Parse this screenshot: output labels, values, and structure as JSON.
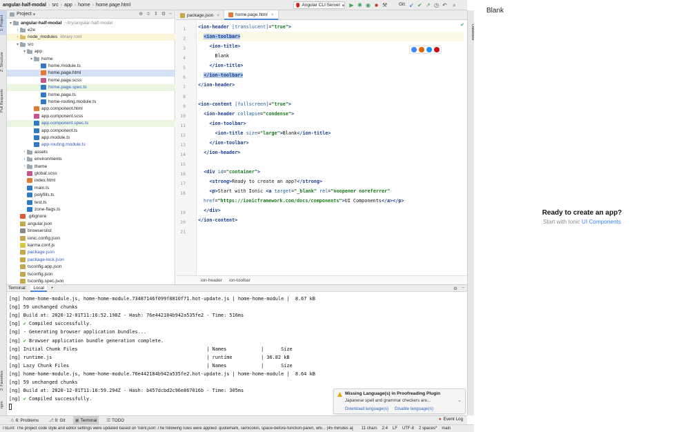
{
  "breadcrumb": [
    "angular-half-modal",
    "src",
    "app",
    "home",
    "home.page.html"
  ],
  "run_config": "Angular CLI Server",
  "git_label": "Git:",
  "left_tool_tabs": [
    "1: Project",
    "Z: Structure",
    "Pull Requests",
    "2: Favorites",
    "npm"
  ],
  "right_tool_tabs": [
    "Database"
  ],
  "project_panel": {
    "title": "Project",
    "tree": [
      {
        "label": "angular-half-modal",
        "hint": "~/try/angular-half-modal",
        "icon": "folder",
        "depth": 0,
        "open": true,
        "bold": true
      },
      {
        "label": "e2e",
        "icon": "folder",
        "depth": 1,
        "open": false
      },
      {
        "label": "node_modules",
        "hint": "library root",
        "icon": "fmod",
        "depth": 1,
        "open": false,
        "style": "hl"
      },
      {
        "label": "src",
        "icon": "folder",
        "depth": 1,
        "open": true
      },
      {
        "label": "app",
        "icon": "folder",
        "depth": 2,
        "open": true
      },
      {
        "label": "home",
        "icon": "folder",
        "depth": 3,
        "open": true
      },
      {
        "label": "home.module.ts",
        "icon": "ts",
        "depth": 4
      },
      {
        "label": "home.page.html",
        "icon": "html",
        "depth": 4,
        "style": "sel"
      },
      {
        "label": "home.page.scss",
        "icon": "scss",
        "depth": 4
      },
      {
        "label": "home.page.spec.ts",
        "icon": "ts",
        "depth": 4,
        "style": "gn",
        "color": "blue"
      },
      {
        "label": "home.page.ts",
        "icon": "ts",
        "depth": 4
      },
      {
        "label": "home-routing.module.ts",
        "icon": "ts",
        "depth": 4
      },
      {
        "label": "app.component.html",
        "icon": "html",
        "depth": 3
      },
      {
        "label": "app.component.scss",
        "icon": "scss",
        "depth": 3
      },
      {
        "label": "app.component.spec.ts",
        "icon": "ts",
        "depth": 3,
        "style": "gn",
        "color": "blue"
      },
      {
        "label": "app.component.ts",
        "icon": "ts",
        "depth": 3
      },
      {
        "label": "app.module.ts",
        "icon": "ts",
        "depth": 3
      },
      {
        "label": "app-routing.module.ts",
        "icon": "ts",
        "depth": 3,
        "color": "blue"
      },
      {
        "label": "assets",
        "icon": "folder",
        "depth": 2,
        "open": false
      },
      {
        "label": "environments",
        "icon": "folder",
        "depth": 2,
        "open": false
      },
      {
        "label": "theme",
        "icon": "folder",
        "depth": 2,
        "open": false
      },
      {
        "label": "global.scss",
        "icon": "scss",
        "depth": 2
      },
      {
        "label": "index.html",
        "icon": "html",
        "depth": 2
      },
      {
        "label": "main.ts",
        "icon": "ts",
        "depth": 2
      },
      {
        "label": "polyfills.ts",
        "icon": "ts",
        "depth": 2
      },
      {
        "label": "test.ts",
        "icon": "ts",
        "depth": 2
      },
      {
        "label": "zone-flags.ts",
        "icon": "ts",
        "depth": 2
      },
      {
        "label": ".gitignore",
        "icon": "git",
        "depth": 1
      },
      {
        "label": "angular.json",
        "icon": "json",
        "depth": 1
      },
      {
        "label": "browserslist",
        "icon": "cfg",
        "depth": 1
      },
      {
        "label": "ionic.config.json",
        "icon": "json",
        "depth": 1
      },
      {
        "label": "karma.conf.js",
        "icon": "js",
        "depth": 1
      },
      {
        "label": "package.json",
        "icon": "json",
        "depth": 1,
        "color": "blue"
      },
      {
        "label": "package-lock.json",
        "icon": "json",
        "depth": 1,
        "color": "blue"
      },
      {
        "label": "tsconfig.app.json",
        "icon": "json",
        "depth": 1
      },
      {
        "label": "tsconfig.json",
        "icon": "json",
        "depth": 1
      },
      {
        "label": "tsconfig.spec.json",
        "icon": "json",
        "depth": 1
      }
    ]
  },
  "editor": {
    "tabs": [
      {
        "label": "package.json",
        "icon": "json",
        "active": false
      },
      {
        "label": "home.page.html",
        "icon": "html",
        "active": true
      }
    ],
    "line_numbers": [
      "1",
      "2",
      "3",
      "4",
      "5",
      "6",
      "7",
      "8",
      "9",
      "10",
      "11",
      "12",
      "13",
      "14",
      "15",
      "16",
      "17",
      "18",
      "",
      "19",
      "20",
      "21"
    ],
    "lines": [
      [
        {
          "c": "t",
          "v": "<ion-header "
        },
        {
          "c": "a",
          "v": "[translucent]"
        },
        {
          "c": "p",
          "v": "="
        },
        {
          "c": "s",
          "v": "\"true\""
        },
        {
          "c": "t",
          "v": ">"
        }
      ],
      [
        {
          "c": "p",
          "v": "  "
        },
        {
          "c": "t sel",
          "v": "<ion-toolbar>"
        }
      ],
      [
        {
          "c": "p",
          "v": "    "
        },
        {
          "c": "t",
          "v": "<ion-title>"
        }
      ],
      [
        {
          "c": "p",
          "v": "      Blank"
        }
      ],
      [
        {
          "c": "p",
          "v": "    "
        },
        {
          "c": "t",
          "v": "</ion-title>"
        }
      ],
      [
        {
          "c": "p",
          "v": "  "
        },
        {
          "c": "t sel",
          "v": "</ion-toolbar>"
        }
      ],
      [
        {
          "c": "t",
          "v": "</ion-header>"
        }
      ],
      [
        {
          "c": "p",
          "v": ""
        }
      ],
      [
        {
          "c": "t",
          "v": "<ion-content "
        },
        {
          "c": "a",
          "v": "[fullscreen]"
        },
        {
          "c": "p",
          "v": "="
        },
        {
          "c": "s",
          "v": "\"true\""
        },
        {
          "c": "t",
          "v": ">"
        }
      ],
      [
        {
          "c": "p",
          "v": "  "
        },
        {
          "c": "t",
          "v": "<ion-header "
        },
        {
          "c": "a",
          "v": "collapse"
        },
        {
          "c": "p",
          "v": "="
        },
        {
          "c": "s",
          "v": "\"condense\""
        },
        {
          "c": "t",
          "v": ">"
        }
      ],
      [
        {
          "c": "p",
          "v": "    "
        },
        {
          "c": "t",
          "v": "<ion-toolbar>"
        }
      ],
      [
        {
          "c": "p",
          "v": "      "
        },
        {
          "c": "t",
          "v": "<ion-title "
        },
        {
          "c": "a",
          "v": "size"
        },
        {
          "c": "p",
          "v": "="
        },
        {
          "c": "s",
          "v": "\"large\""
        },
        {
          "c": "t",
          "v": ">"
        },
        {
          "c": "p",
          "v": "Blank"
        },
        {
          "c": "t",
          "v": "</ion-title>"
        }
      ],
      [
        {
          "c": "p",
          "v": "    "
        },
        {
          "c": "t",
          "v": "</ion-toolbar>"
        }
      ],
      [
        {
          "c": "p",
          "v": "  "
        },
        {
          "c": "t",
          "v": "</ion-header>"
        }
      ],
      [
        {
          "c": "p",
          "v": ""
        }
      ],
      [
        {
          "c": "p",
          "v": "  "
        },
        {
          "c": "t",
          "v": "<div "
        },
        {
          "c": "a",
          "v": "id"
        },
        {
          "c": "p",
          "v": "="
        },
        {
          "c": "s",
          "v": "\"container\""
        },
        {
          "c": "t",
          "v": ">"
        }
      ],
      [
        {
          "c": "p",
          "v": "    "
        },
        {
          "c": "t",
          "v": "<strong>"
        },
        {
          "c": "p",
          "v": "Ready to create an app?"
        },
        {
          "c": "t",
          "v": "</strong>"
        }
      ],
      [
        {
          "c": "p",
          "v": "    "
        },
        {
          "c": "t",
          "v": "<p>"
        },
        {
          "c": "p",
          "v": "Start with Ionic "
        },
        {
          "c": "t",
          "v": "<a "
        },
        {
          "c": "a",
          "v": "target"
        },
        {
          "c": "p",
          "v": "="
        },
        {
          "c": "s",
          "v": "\"_blank\""
        },
        {
          "c": "p",
          "v": " "
        },
        {
          "c": "a",
          "v": "rel"
        },
        {
          "c": "p",
          "v": "="
        },
        {
          "c": "s",
          "v": "\"noopener noreferrer\""
        }
      ],
      [
        {
          "c": "a",
          "v": "href"
        },
        {
          "c": "p",
          "v": "="
        },
        {
          "c": "s",
          "v": "\"https://ionicframework.com/docs/components\""
        },
        {
          "c": "t",
          "v": ">"
        },
        {
          "c": "p",
          "v": "UI Components"
        },
        {
          "c": "t",
          "v": "</a></p>"
        }
      ],
      [
        {
          "c": "p",
          "v": "  "
        },
        {
          "c": "t",
          "v": "</div>"
        }
      ],
      [
        {
          "c": "t",
          "v": "</ion-content>"
        }
      ],
      [
        {
          "c": "p",
          "v": ""
        }
      ]
    ],
    "breadcrumb": [
      "ion-header",
      "ion-toolbar"
    ]
  },
  "terminal": {
    "title": "Terminal:",
    "tab": "Local",
    "add": "+",
    "lines": [
      "[ng] home-home-module.js, home-home-module.73487146f099f8810f71.hot-update.js | home-home-module |  8.67 kB",
      "[ng] 59 unchanged chunks",
      "[ng] Build at: 2020-12-01T11:16:52.198Z - Hash: 76e442184b942a535fe2 - Time: 516ms",
      "[ng] ✔ Compiled successfully.",
      "[ng] - Generating browser application bundles...",
      "[ng] ✔ Browser application bundle generation complete.",
      "[ng] Initial Chunk Files                                             | Names            |      Size",
      "[ng] runtime.js                                                      | runtime          | 36.82 kB",
      "[ng] Lazy Chunk Files                                                | Names            |      Size",
      "[ng] home-home-module.js, home-home-module.76e442184b942a535fe2.hot-update.js | home-home-module |  8.64 kB",
      "[ng] 59 unchanged chunks",
      "[ng] Build at: 2020-12-01T11:16:59.294Z - Hash: b457dcbd2c96e867016b - Time: 305ms",
      "[ng] ✔ Compiled successfully."
    ]
  },
  "notification": {
    "title": "Missing Language(s) in Proofreading Plugin",
    "body": "Japanese spell and grammar checkers are...",
    "link1": "Download language(s)",
    "link2": "Disable language(s)"
  },
  "tool_windows": [
    {
      "label": "6: Problems",
      "active": false
    },
    {
      "label": "9: Git",
      "active": false
    },
    {
      "label": "Terminal",
      "active": true
    },
    {
      "label": "TODO",
      "active": false
    }
  ],
  "event_log": "Event Log",
  "status_bar": {
    "message": "TSLint: The project code style and editor settings were updated based on 'tslint.json'.The following rules were applied: quotemark, semicolon, space-before-function-paren, whi... (45 minutes ago)",
    "chars": "11 chars",
    "position": "2:4",
    "line_sep": "LF",
    "encoding": "UTF-8",
    "indent": "2 spaces*",
    "branch": "main"
  },
  "preview": {
    "title": "Blank",
    "strong": "Ready to create an app?",
    "p_prefix": "Start with Ionic ",
    "p_link": "UI Components"
  },
  "colors": {
    "accent": "#4a88d8",
    "ionic_link": "#3880ff",
    "ok": "#22a322"
  }
}
